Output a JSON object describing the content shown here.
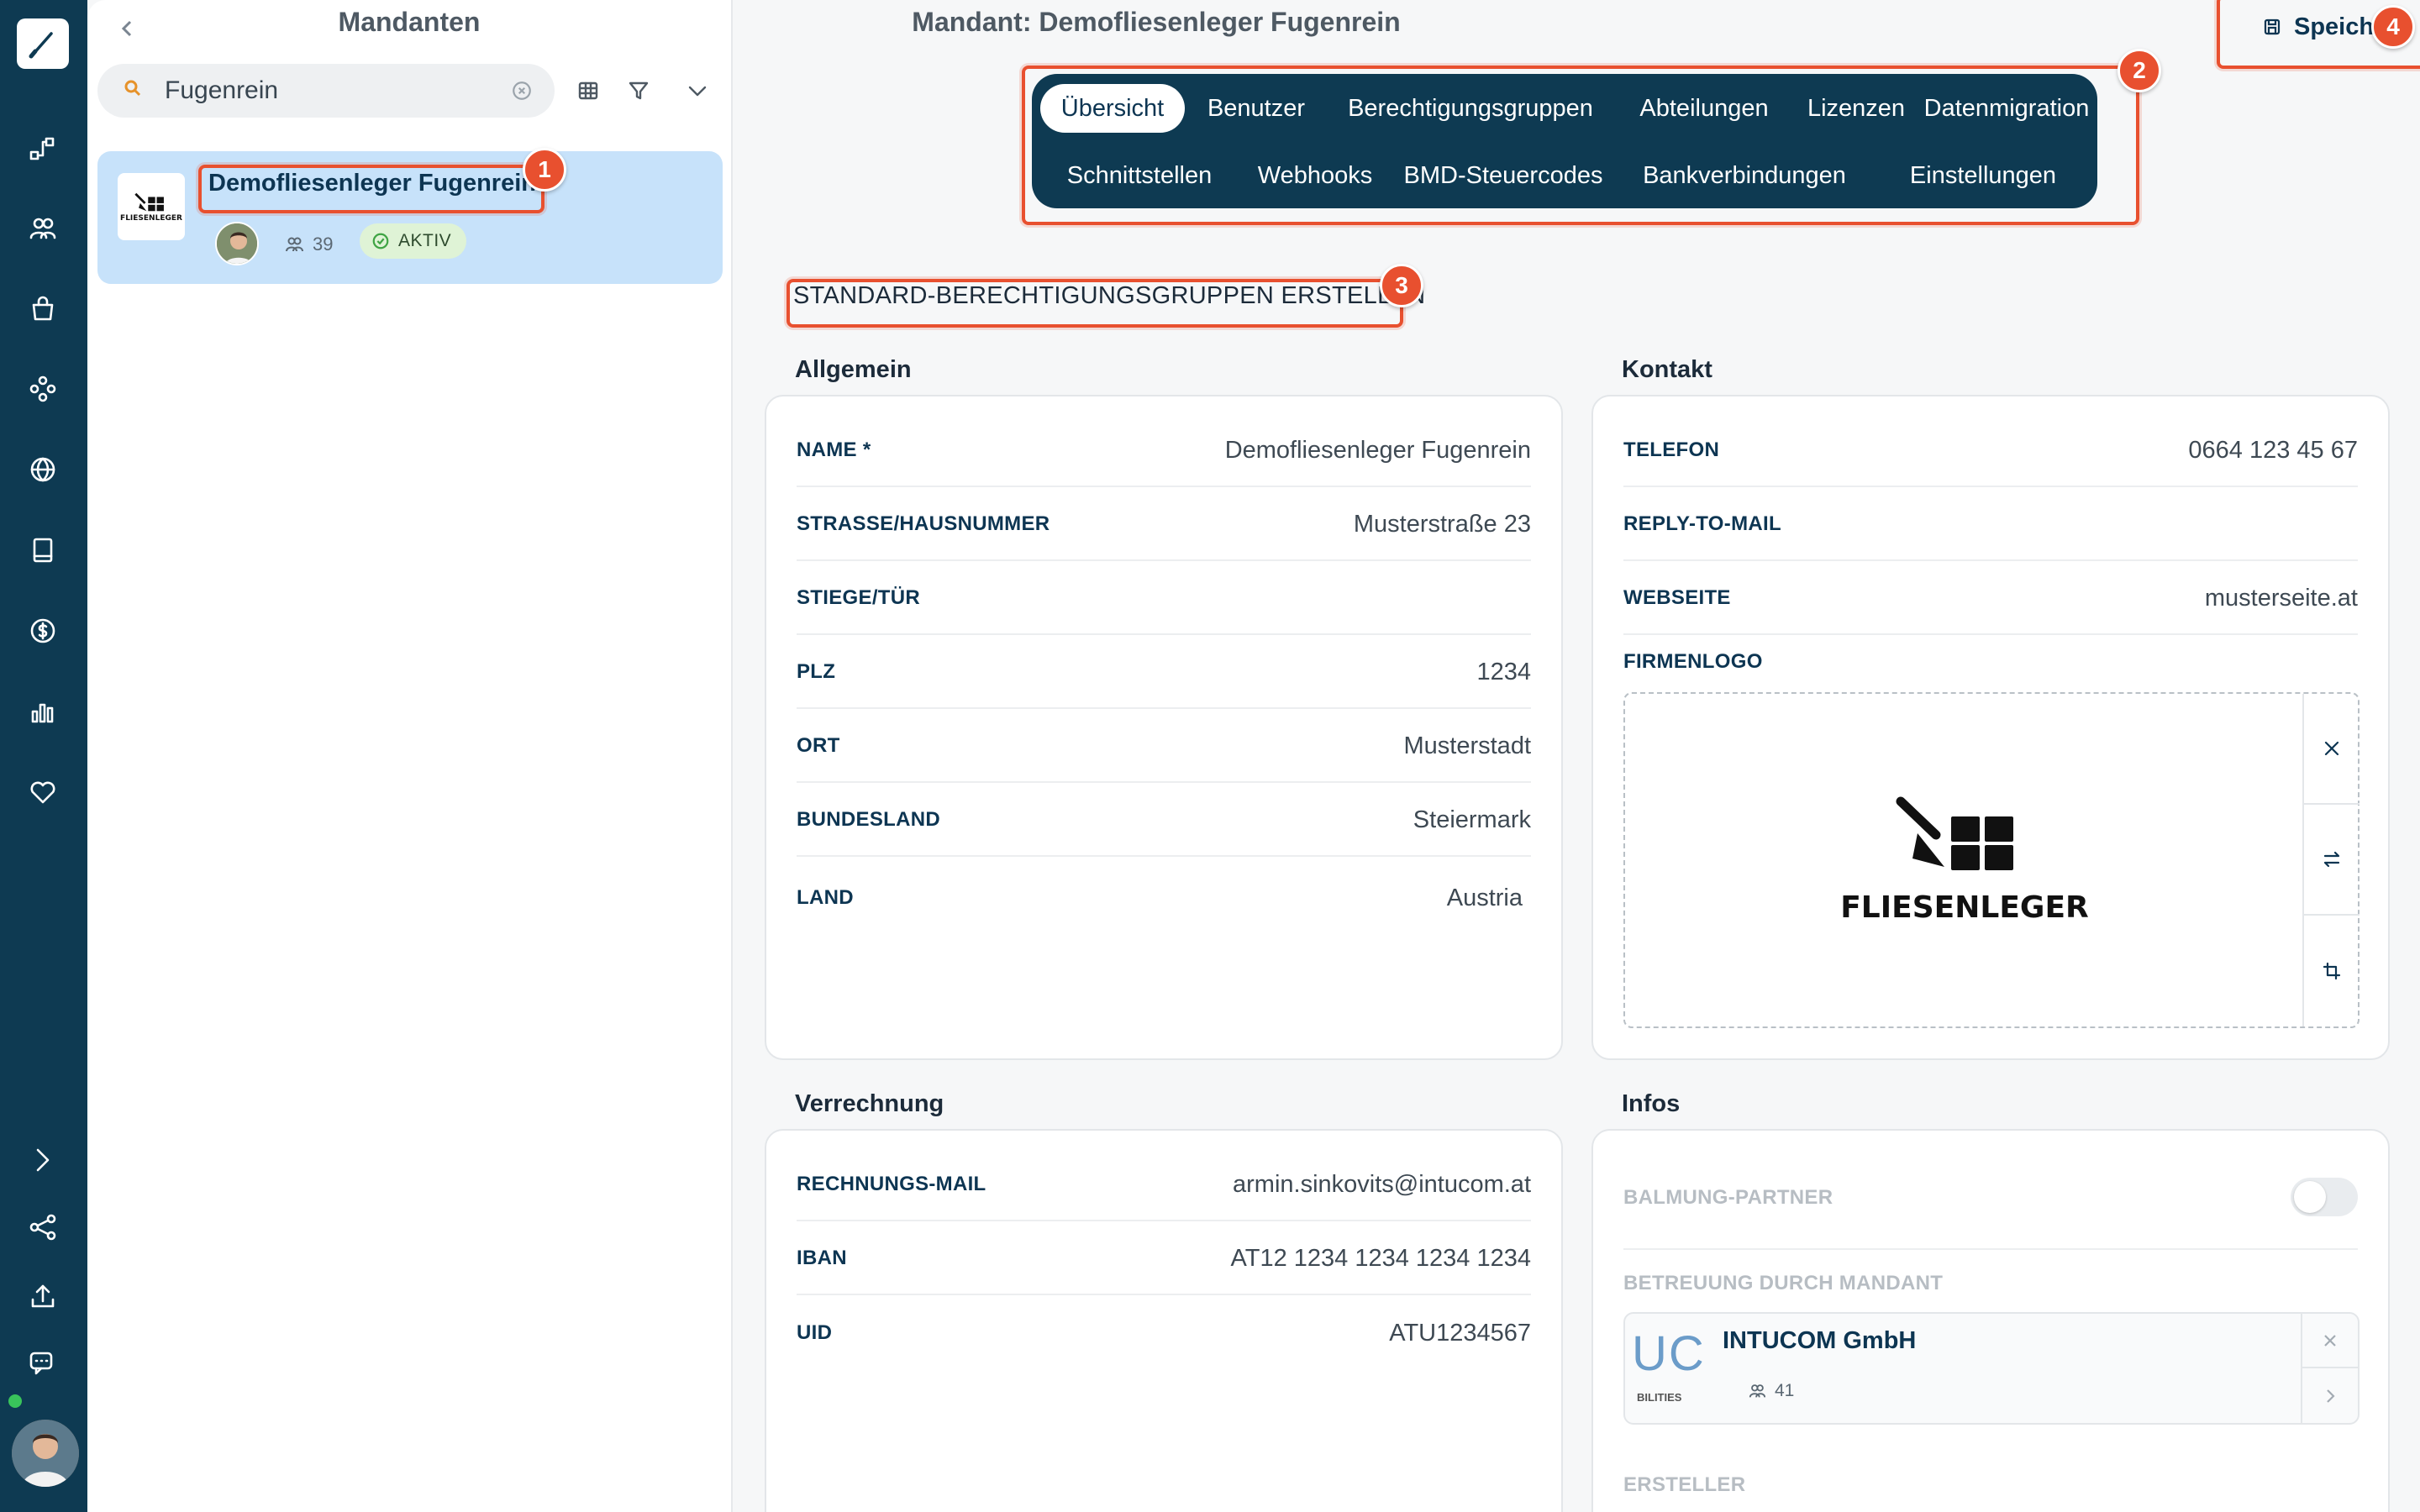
{
  "nav": {
    "items": [
      "brush",
      "workflow",
      "users",
      "shopping-bag",
      "network",
      "globe",
      "book",
      "dollar",
      "chart",
      "heart",
      "expand",
      "share",
      "upload",
      "chat"
    ]
  },
  "list_panel": {
    "title": "Mandanten",
    "search_value": "Fugenrein",
    "entries": [
      {
        "name": "Demofliesenleger Fugenrein",
        "logo_text": "FLIESENLEGER",
        "user_count": "39",
        "status": "AKTIV"
      }
    ]
  },
  "main": {
    "title": "Mandant: Demofliesenleger Fugenrein",
    "save_label": "Speiche",
    "tabs": [
      {
        "label": "Übersicht",
        "active": true
      },
      {
        "label": "Benutzer"
      },
      {
        "label": "Berechtigungsgruppen"
      },
      {
        "label": "Abteilungen"
      },
      {
        "label": "Lizenzen"
      },
      {
        "label": "Datenmigration"
      },
      {
        "label": "Schnittstellen"
      },
      {
        "label": "Webhooks"
      },
      {
        "label": "BMD-Steuercodes"
      },
      {
        "label": "Bankverbindungen"
      },
      {
        "label": "Einstellungen"
      }
    ],
    "std_groups_link": "STANDARD-BERECHTIGUNGSGRUPPEN ERSTELLEN",
    "allgemein": {
      "title": "Allgemein",
      "fields": [
        {
          "label": "NAME *",
          "value": "Demofliesenleger Fugenrein"
        },
        {
          "label": "STRASSE/HAUSNUMMER",
          "value": "Musterstraße 23"
        },
        {
          "label": "STIEGE/TÜR",
          "value": ""
        },
        {
          "label": "PLZ",
          "value": "1234"
        },
        {
          "label": "ORT",
          "value": "Musterstadt"
        },
        {
          "label": "BUNDESLAND",
          "value": "Steiermark"
        },
        {
          "label": "LAND",
          "value": "Austria"
        }
      ]
    },
    "kontakt": {
      "title": "Kontakt",
      "fields": [
        {
          "label": "TELEFON",
          "value": "0664 123 45 67"
        },
        {
          "label": "REPLY-TO-MAIL",
          "value": ""
        },
        {
          "label": "WEBSEITE",
          "value": "musterseite.at"
        }
      ],
      "logo_label": "FIRMENLOGO",
      "logo_text": "FLIESENLEGER"
    },
    "verrechnung": {
      "title": "Verrechnung",
      "fields": [
        {
          "label": "RECHNUNGS-MAIL",
          "value": "armin.sinkovits@intucom.at"
        },
        {
          "label": "IBAN",
          "value": "AT12 1234 1234 1234 1234"
        },
        {
          "label": "UID",
          "value": "ATU1234567"
        }
      ]
    },
    "infos": {
      "title": "Infos",
      "balmung_label": "BALMUNG-PARTNER",
      "balmung_enabled": false,
      "betreuung_label": "BETREUUNG DURCH MANDANT",
      "partner": {
        "name": "INTUCOM GmbH",
        "user_count": "41",
        "logo_text": "UC",
        "logo_sub": "BILITIES"
      },
      "ersteller_label": "ERSTELLER"
    }
  },
  "annotations": [
    "1",
    "2",
    "3",
    "4"
  ],
  "colors": {
    "nav_bg": "#0e3a52",
    "accent": "#e8502f",
    "selected_bg": "#c7e2fa",
    "active_badge": "#dff3d6"
  }
}
